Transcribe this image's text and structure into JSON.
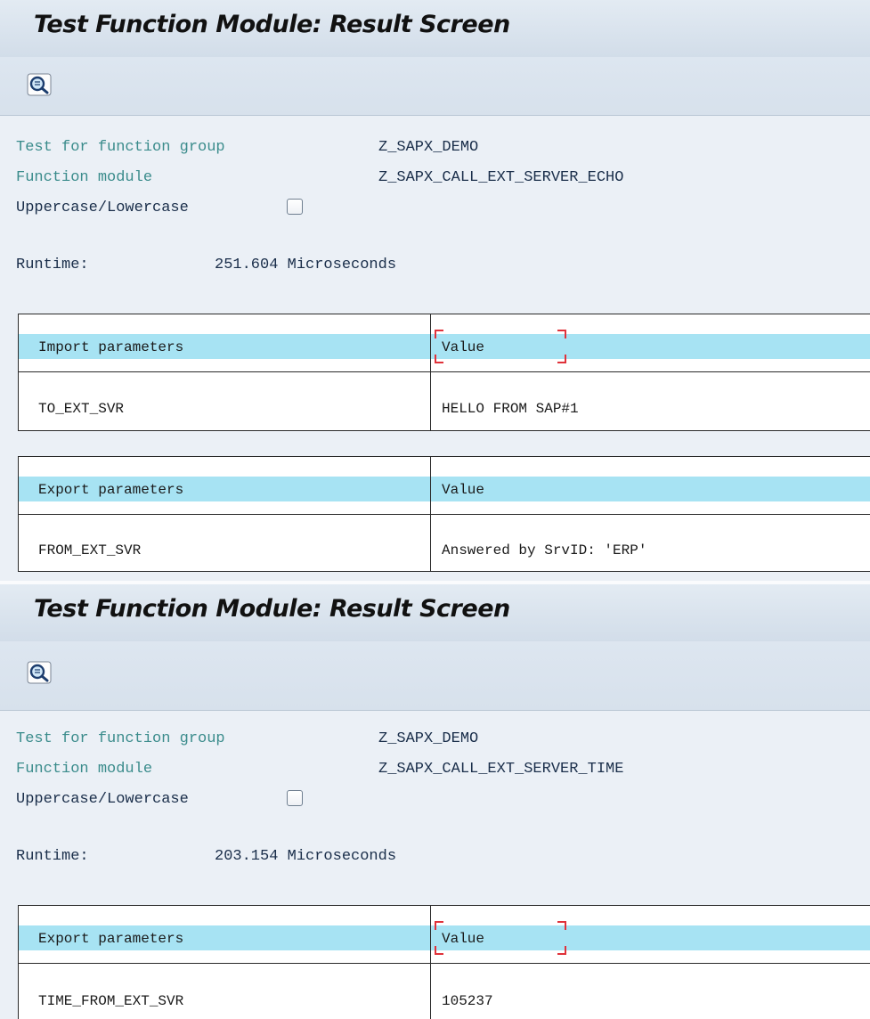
{
  "screens": [
    {
      "title": "Test Function Module: Result Screen",
      "toolbar_icon": "detail-view-icon",
      "info": {
        "group_label": "Test for function group",
        "group_value": "Z_SAPX_DEMO",
        "module_label": "Function module",
        "module_value": "Z_SAPX_CALL_EXT_SERVER_ECHO",
        "case_label": "Uppercase/Lowercase",
        "case_checked": false,
        "runtime_label": "Runtime:",
        "runtime_value": "251.604 Microseconds"
      },
      "tables": [
        {
          "header": [
            "Import parameters",
            "Value"
          ],
          "rows": [
            [
              "TO_EXT_SVR",
              "HELLO FROM SAP#1"
            ]
          ]
        },
        {
          "header": [
            "Export parameters",
            "Value"
          ],
          "rows": [
            [
              "FROM_EXT_SVR",
              "Answered by SrvID: 'ERP'"
            ]
          ]
        }
      ]
    },
    {
      "title": "Test Function Module: Result Screen",
      "toolbar_icon": "detail-view-icon",
      "info": {
        "group_label": "Test for function group",
        "group_value": "Z_SAPX_DEMO",
        "module_label": "Function module",
        "module_value": "Z_SAPX_CALL_EXT_SERVER_TIME",
        "case_label": "Uppercase/Lowercase",
        "case_checked": false,
        "runtime_label": "Runtime:",
        "runtime_value": "203.154 Microseconds"
      },
      "tables": [
        {
          "header": [
            "Export parameters",
            "Value"
          ],
          "rows": [
            [
              "TIME_FROM_EXT_SVR",
              "105237"
            ]
          ]
        }
      ]
    }
  ],
  "colors": {
    "header_row": "#a7e3f3",
    "label_teal": "#3b8c8c",
    "label_dark": "#1a2e4a",
    "focus_marker": "#e0323a",
    "background": "#ebf0f6"
  }
}
